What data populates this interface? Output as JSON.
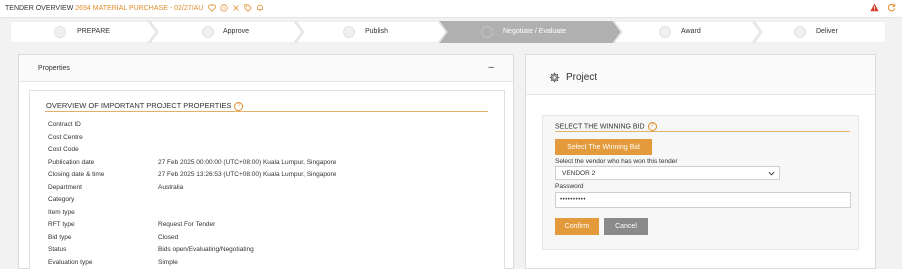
{
  "topbar": {
    "title": "TENDER OVERVIEW",
    "subtitle": "2694 MATERIAL PURCHASE - 02/27/AU",
    "icons": [
      "heart-icon",
      "copy-icon",
      "link-icon",
      "tag-icon",
      "bell-icon"
    ],
    "right_icons": [
      "warning-icon",
      "refresh-icon"
    ]
  },
  "stepper": {
    "steps": [
      {
        "label": "PREPARE",
        "active": false
      },
      {
        "label": "Approve",
        "active": false
      },
      {
        "label": "Publish",
        "active": false
      },
      {
        "label": "Negotiate / Evaluate",
        "active": true
      },
      {
        "label": "Award",
        "active": false
      },
      {
        "label": "Deliver",
        "active": false
      }
    ]
  },
  "left": {
    "header": "Properties",
    "collapse": "–",
    "section_title": "OVERVIEW OF IMPORTANT PROJECT PROPERTIES",
    "help": "?",
    "rows": [
      {
        "label": "Contract ID",
        "value": ""
      },
      {
        "label": "Cost Centre",
        "value": ""
      },
      {
        "label": "Cost Code",
        "value": ""
      },
      {
        "label": "Publication date",
        "value": "27 Feb 2025 00:00:00 (UTC+08:00) Kuala Lumpur, Singapore"
      },
      {
        "label": "Closing date & time",
        "value": "27 Feb 2025 13:26:53 (UTC+08:00) Kuala Lumpur, Singapore"
      },
      {
        "label": "Department",
        "value": "Australia"
      },
      {
        "label": "Category",
        "value": ""
      },
      {
        "label": "Item type",
        "value": ""
      },
      {
        "label": "RFT type",
        "value": "Request For Tender"
      },
      {
        "label": "Bid type",
        "value": "Closed"
      },
      {
        "label": "Status",
        "value": "Bids open/Evaluating/Negotiating"
      },
      {
        "label": "Evaluation type",
        "value": "Simple"
      }
    ]
  },
  "right": {
    "title": "Project",
    "section_title": "SELECT THE WINNING BID",
    "help": "?",
    "select_button": "Select The Winning Bid",
    "vendor_label": "Select the vendor who has won this tender",
    "vendor_value": "VENDOR 2",
    "password_label": "Password",
    "password_value": "••••••••••",
    "confirm": "Confirm",
    "cancel": "Cancel"
  },
  "colors": {
    "accent": "#e08e2b",
    "button_orange": "#e39a3b",
    "button_gray": "#8a8a8a",
    "active_step": "#b0b0b0",
    "warning": "#d9392c"
  }
}
